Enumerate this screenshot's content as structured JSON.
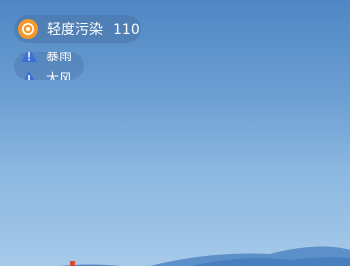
{
  "air_quality": {
    "label": "轻度污染",
    "value": "110",
    "icon": "air-quality-icon",
    "color": "#f39a2b"
  },
  "alerts": [
    {
      "label": "暴雨",
      "icon": "warning-triangle-icon",
      "color": "#3d6fd8"
    },
    {
      "label": "大风",
      "icon": "warning-triangle-icon",
      "color": "#3d6fd8"
    }
  ]
}
